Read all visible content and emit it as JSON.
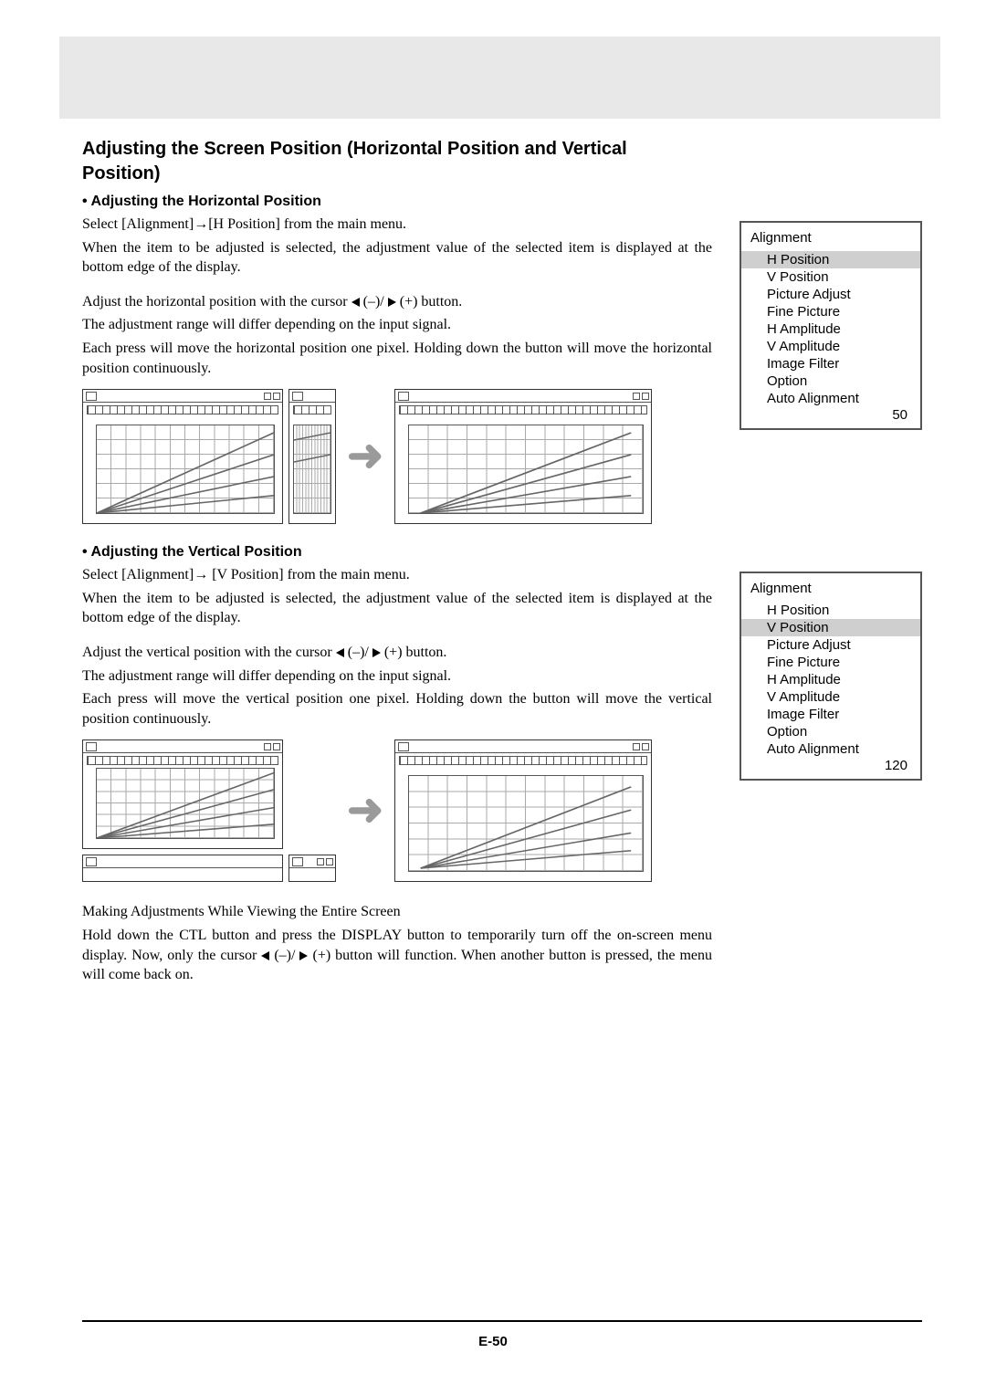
{
  "heading": "Adjusting the Screen Position (Horizontal Position and Vertical Position)",
  "h_section": {
    "subheading": "• Adjusting the Horizontal Position",
    "p1": "Select [Alignment]→[H Position] from the main menu.",
    "p2": "When the item to be adjusted is selected, the adjustment value of the selected item is displayed at the bottom edge of the display.",
    "p3_a": "Adjust the horizontal position with the cursor ",
    "p3_b": " (–)/ ",
    "p3_c": " (+) button.",
    "p4": "The adjustment range will differ depending on the input signal.",
    "p5": "Each press will move the horizontal position one pixel. Holding down the button will move the horizontal position continuously."
  },
  "v_section": {
    "subheading": "• Adjusting the Vertical Position",
    "p1": "Select [Alignment]→ [V Position] from the main menu.",
    "p2": "When the item to be adjusted is selected, the adjustment value of the selected item is displayed at the bottom edge of the display.",
    "p3_a": "Adjust the vertical position with the cursor ",
    "p3_b": " (–)/ ",
    "p3_c": " (+) button.",
    "p4": "The adjustment range will differ depending on the input signal.",
    "p5": "Each press will move the vertical position one pixel. Holding down the button will move the vertical position continuously."
  },
  "final": {
    "p1": "Making Adjustments While Viewing the Entire Screen",
    "p2_a": "Hold down the CTL button and press the DISPLAY button to temporarily turn off the on-screen menu display. Now, only the cursor ",
    "p2_b": " (–)/ ",
    "p2_c": " (+) button will function. When another button is pressed, the menu will come back on."
  },
  "menu": {
    "title": "Alignment",
    "items": [
      "H Position",
      "V Position",
      "Picture Adjust",
      "Fine Picture",
      "H Amplitude",
      "V Amplitude",
      "Image Filter",
      "Option",
      "Auto Alignment"
    ],
    "h_selected_index": 0,
    "v_selected_index": 1,
    "h_value": "50",
    "v_value": "120"
  },
  "page_number": "E-50"
}
